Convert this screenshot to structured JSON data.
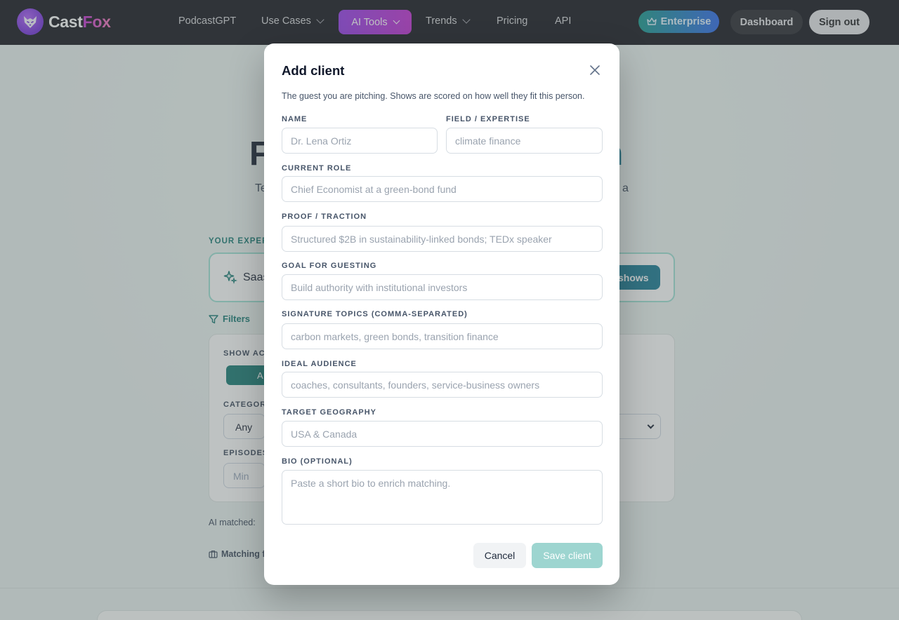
{
  "nav": {
    "logo_part1": "Cast",
    "logo_part2": "Fox",
    "items": [
      {
        "label": "PodcastGPT"
      },
      {
        "label": "Use Cases"
      },
      {
        "label": "AI Tools"
      },
      {
        "label": "Trends"
      },
      {
        "label": "Pricing"
      },
      {
        "label": "API"
      }
    ],
    "enterprise": "Enterprise",
    "dashboard": "Dashboard",
    "signout": "Sign out"
  },
  "background": {
    "hero_title_start": "F",
    "hero_title_end": "n",
    "hero_sub_start": "Te",
    "hero_sub_end": "a",
    "expertise_label": "YOUR EXPER",
    "expertise_value": "Saas",
    "shows_button": "shows",
    "filters": "Filters",
    "show_active_label": "SHOW AC",
    "active_button": "A",
    "category_label": "CATEGOR",
    "category_value": "Any",
    "episodes_label": "EPISODES",
    "episodes_min_placeholder": "Min",
    "ai_matched": "AI matched:",
    "matching": "Matching f"
  },
  "modal": {
    "title": "Add client",
    "description": "The guest you are pitching. Shows are scored on how well they fit this person.",
    "fields": {
      "name": {
        "label": "NAME",
        "placeholder": "Dr. Lena Ortiz",
        "value": ""
      },
      "field": {
        "label": "FIELD / EXPERTISE",
        "placeholder": "climate finance",
        "value": ""
      },
      "role": {
        "label": "CURRENT ROLE",
        "placeholder": "Chief Economist at a green-bond fund",
        "value": ""
      },
      "proof": {
        "label": "PROOF / TRACTION",
        "placeholder": "Structured $2B in sustainability-linked bonds; TEDx speaker",
        "value": ""
      },
      "goal": {
        "label": "GOAL FOR GUESTING",
        "placeholder": "Build authority with institutional investors",
        "value": ""
      },
      "topics": {
        "label": "SIGNATURE TOPICS (COMMA-SEPARATED)",
        "placeholder": "carbon markets, green bonds, transition finance",
        "value": ""
      },
      "audience": {
        "label": "IDEAL AUDIENCE",
        "placeholder": "coaches, consultants, founders, service-business owners",
        "value": ""
      },
      "geography": {
        "label": "TARGET GEOGRAPHY",
        "placeholder": "USA & Canada",
        "value": ""
      },
      "bio": {
        "label": "BIO (OPTIONAL)",
        "placeholder": "Paste a short bio to enrich matching.",
        "value": ""
      }
    },
    "cancel": "Cancel",
    "save": "Save client"
  }
}
